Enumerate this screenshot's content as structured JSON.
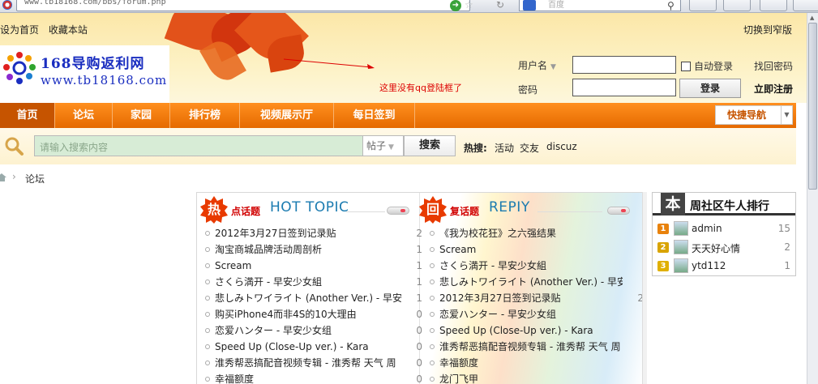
{
  "browser": {
    "url": "www.tb18168.com/bbs/forum.php",
    "search_placeholder": "百度"
  },
  "header": {
    "set_home": "设为首页",
    "bookmark": "收藏本站",
    "switch_width": "切换到窄版",
    "logo_title": "168导购返利网",
    "logo_url": "www.tb18168.com",
    "annotation": "这里没有qq登陆框了",
    "username_label": "用户名",
    "password_label": "密码",
    "auto_login": "自动登录",
    "find_password": "找回密码",
    "login_button": "登录",
    "register": "立即注册"
  },
  "nav": {
    "items": [
      "首页",
      "论坛",
      "家园",
      "排行榜",
      "视频展示厅",
      "每日签到"
    ],
    "quick_nav": "快捷导航"
  },
  "search": {
    "placeholder": "请输入搜索内容",
    "type": "帖子",
    "button": "搜索",
    "hot_label": "热搜:",
    "hot_words": [
      "活动",
      "交友",
      "discuz"
    ]
  },
  "breadcrumb": {
    "current": "论坛"
  },
  "hot_panel": {
    "burst": "热",
    "title_cn": "点话题",
    "title_en": "HOT TOPIC",
    "items": [
      {
        "title": "2012年3月27日签到记录贴",
        "count": "2"
      },
      {
        "title": "淘宝商城品牌活动周剖析",
        "count": "1"
      },
      {
        "title": "Scream",
        "count": "1"
      },
      {
        "title": "さくら満开 - 早安少女組",
        "count": "1"
      },
      {
        "title": "悲しみトワイライト (Another Ver.) - 早安",
        "count": "1"
      },
      {
        "title": "购买iPhone4而非4S的10大理由",
        "count": "0"
      },
      {
        "title": "恋爱ハンター - 早安少女组",
        "count": "0"
      },
      {
        "title": "Speed Up (Close-Up ver.) - Kara",
        "count": "0"
      },
      {
        "title": "淮秀帮恶搞配音视频专辑 - 淮秀帮 天气 周",
        "count": "0"
      },
      {
        "title": "幸福额度",
        "count": "0"
      }
    ]
  },
  "reply_panel": {
    "burst": "回",
    "title_cn": "复话题",
    "title_en": "REPIY",
    "items": [
      {
        "title": "《我为校花狂》之六强结果",
        "count": ""
      },
      {
        "title": "Scream",
        "count": ""
      },
      {
        "title": "さくら満开 - 早安少女組",
        "count": ""
      },
      {
        "title": "悲しみトワイライト (Another Ver.) - 早安",
        "count": ""
      },
      {
        "title": "2012年3月27日签到记录贴",
        "count": "2"
      },
      {
        "title": "恋爱ハンター - 早安少女组",
        "count": ""
      },
      {
        "title": "Speed Up (Close-Up ver.) - Kara",
        "count": ""
      },
      {
        "title": "淮秀帮恶搞配音视频专辑 - 淮秀帮 天气 周",
        "count": ""
      },
      {
        "title": "幸福额度",
        "count": ""
      },
      {
        "title": "龙门飞甲",
        "count": ""
      }
    ]
  },
  "rank": {
    "char": "本",
    "title": "周社区牛人排行",
    "items": [
      {
        "num": "1",
        "name": "admin",
        "count": "15",
        "color": "#e8820c"
      },
      {
        "num": "2",
        "name": "天天好心情",
        "count": "2",
        "color": "#d9a400"
      },
      {
        "num": "3",
        "name": "ytd112",
        "count": "1",
        "color": "#e0b000"
      }
    ]
  },
  "colors": {
    "nav_orange": "#f07a0a",
    "brand_blue": "#1a2ec0",
    "hot_red": "#d10000",
    "topic_blue": "#1b7bb0"
  }
}
